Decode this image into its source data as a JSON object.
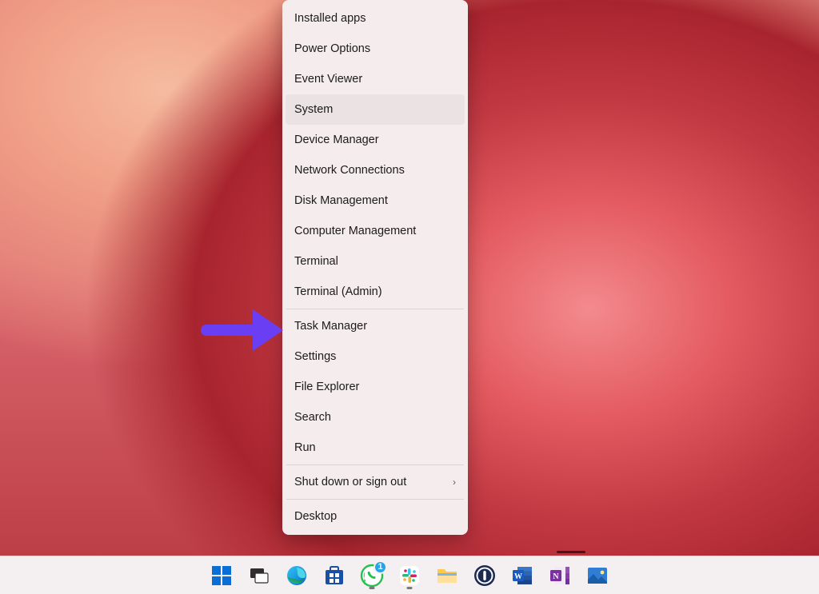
{
  "context_menu": {
    "items": [
      {
        "label": "Installed apps",
        "hovered": false,
        "sep": false,
        "sub": false
      },
      {
        "label": "Power Options",
        "hovered": false,
        "sep": false,
        "sub": false
      },
      {
        "label": "Event Viewer",
        "hovered": false,
        "sep": false,
        "sub": false
      },
      {
        "label": "System",
        "hovered": true,
        "sep": false,
        "sub": false
      },
      {
        "label": "Device Manager",
        "hovered": false,
        "sep": false,
        "sub": false
      },
      {
        "label": "Network Connections",
        "hovered": false,
        "sep": false,
        "sub": false
      },
      {
        "label": "Disk Management",
        "hovered": false,
        "sep": false,
        "sub": false
      },
      {
        "label": "Computer Management",
        "hovered": false,
        "sep": false,
        "sub": false
      },
      {
        "label": "Terminal",
        "hovered": false,
        "sep": false,
        "sub": false
      },
      {
        "label": "Terminal (Admin)",
        "hovered": false,
        "sep": true,
        "sub": false
      },
      {
        "label": "Task Manager",
        "hovered": false,
        "sep": false,
        "sub": false
      },
      {
        "label": "Settings",
        "hovered": false,
        "sep": false,
        "sub": false
      },
      {
        "label": "File Explorer",
        "hovered": false,
        "sep": false,
        "sub": false
      },
      {
        "label": "Search",
        "hovered": false,
        "sep": false,
        "sub": false
      },
      {
        "label": "Run",
        "hovered": false,
        "sep": true,
        "sub": false
      },
      {
        "label": "Shut down or sign out",
        "hovered": false,
        "sep": true,
        "sub": true
      },
      {
        "label": "Desktop",
        "hovered": false,
        "sep": false,
        "sub": false
      }
    ]
  },
  "annotation": {
    "target": "Task Manager"
  },
  "taskbar": {
    "badge_count": "1",
    "icons": [
      {
        "name": "start",
        "pill": false
      },
      {
        "name": "task-view",
        "pill": false
      },
      {
        "name": "edge",
        "pill": false
      },
      {
        "name": "microsoft-store",
        "pill": false
      },
      {
        "name": "whatsapp",
        "pill": true,
        "badge": true
      },
      {
        "name": "slack",
        "pill": true
      },
      {
        "name": "file-explorer",
        "pill": false
      },
      {
        "name": "1password",
        "pill": false
      },
      {
        "name": "word",
        "pill": false
      },
      {
        "name": "onenote",
        "pill": false
      },
      {
        "name": "pictures",
        "pill": false
      }
    ]
  }
}
